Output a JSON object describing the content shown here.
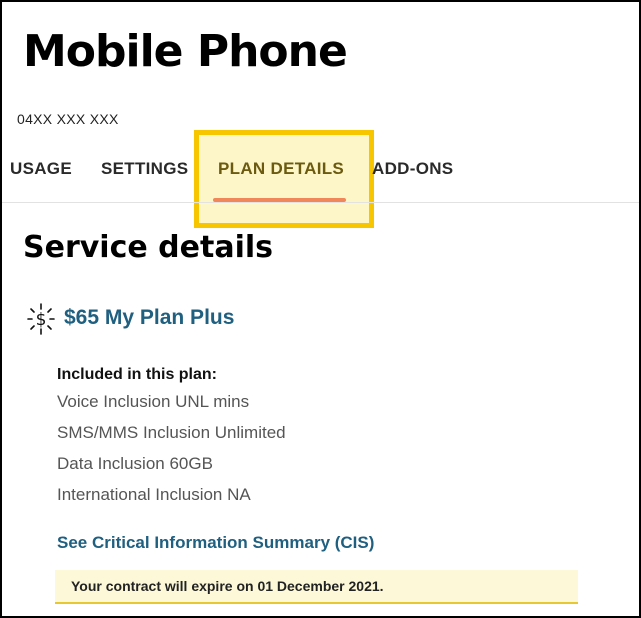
{
  "header": {
    "title": "Mobile Phone",
    "phone_number": "04XX XXX XXX"
  },
  "tabs": [
    {
      "label": "USAGE"
    },
    {
      "label": "SETTINGS"
    },
    {
      "label": "PLAN DETAILS",
      "active": true
    },
    {
      "label": "ADD-ONS"
    }
  ],
  "service": {
    "section_title": "Service details",
    "plan_icon": "dollar-sparkle-icon",
    "plan_name": "$65 My Plan Plus",
    "included_heading": "Included in this plan:",
    "included_items": [
      "Voice Inclusion UNL mins",
      "SMS/MMS Inclusion Unlimited",
      "Data Inclusion 60GB",
      "International Inclusion NA"
    ],
    "cis_link": "See Critical Information Summary (CIS)",
    "contract_notice": "Your contract will expire on 01 December 2021."
  },
  "colors": {
    "link": "#1f5f80",
    "highlight_border": "#f7c600",
    "active_underline": "#f0875a",
    "notice_background": "#fdf8d8"
  }
}
